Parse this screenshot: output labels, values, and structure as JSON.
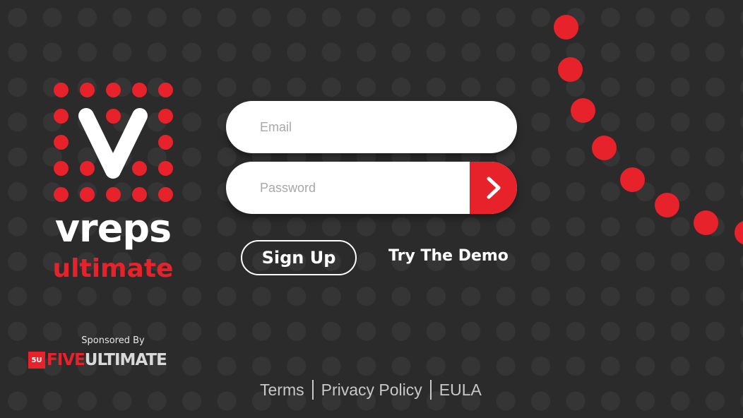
{
  "brand": {
    "name": "vreps",
    "sub": "ultimate"
  },
  "sponsor": {
    "label": "Sponsored By",
    "mark": "5U",
    "name_part1": "FIVE",
    "name_part2": "ULTIMATE"
  },
  "login": {
    "email_placeholder": "Email",
    "password_placeholder": "Password",
    "submit_icon": "chevron-right-icon"
  },
  "actions": {
    "signup_label": "Sign Up",
    "demo_label": "Try The Demo"
  },
  "footer": {
    "terms": "Terms",
    "privacy": "Privacy Policy",
    "eula": "EULA"
  },
  "colors": {
    "accent": "#e8222a",
    "background": "#2b2b2b"
  }
}
